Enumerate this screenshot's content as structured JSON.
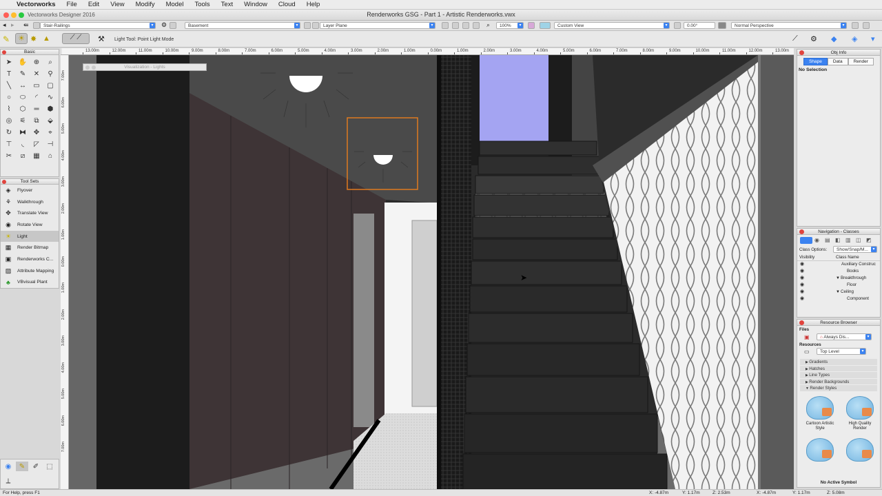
{
  "menubar": {
    "app": "Vectorworks",
    "items": [
      "File",
      "Edit",
      "View",
      "Modify",
      "Model",
      "Tools",
      "Text",
      "Window",
      "Cloud",
      "Help"
    ]
  },
  "window": {
    "app_subtitle": "Vectorworks Designer 2016",
    "title": "Renderworks GSG - Part 1 - Artistic Renderworks.vwx"
  },
  "viewbar": {
    "class": "Stair-Railings",
    "layer": "Basement",
    "plane": "Layer Plane",
    "zoom": "100%",
    "view": "Custom View",
    "angle": "0.00°",
    "projection": "Normal Perspective"
  },
  "modebar": {
    "label": "Light Tool: Point Light Mode"
  },
  "basic_palette": {
    "title": "Basic",
    "tools": [
      "arrow-icon",
      "hand-icon",
      "zoom-marquee-icon",
      "zoom-icon",
      "text-icon",
      "callout-icon",
      "locus-icon",
      "eyedropper-icon",
      "line-icon",
      "dimension-icon",
      "rectangle-icon",
      "rounded-rect-icon",
      "circle-icon",
      "oval-icon",
      "arc-icon",
      "freehand-icon",
      "polyline-icon",
      "polygon-icon",
      "double-line-icon",
      "regular-polygon-icon",
      "spiral-icon",
      "attribute-icon",
      "offset-icon",
      "symbol-icon",
      "rotate-icon",
      "mirror-icon",
      "move-icon",
      "reshape-icon",
      "trim-icon",
      "fillet-icon",
      "chamfer-icon",
      "connect-icon",
      "split-icon",
      "clip-icon",
      "wall-icon",
      "seat-icon"
    ]
  },
  "tool_sets": {
    "title": "Tool Sets",
    "items": [
      {
        "label": "Flyover",
        "icon": "flyover-icon"
      },
      {
        "label": "Walkthrough",
        "icon": "walkthrough-icon"
      },
      {
        "label": "Translate View",
        "icon": "translate-view-icon"
      },
      {
        "label": "Rotate View",
        "icon": "rotate-view-icon"
      },
      {
        "label": "Light",
        "icon": "light-bulb-icon",
        "selected": true
      },
      {
        "label": "Render Bitmap",
        "icon": "render-bitmap-icon"
      },
      {
        "label": "Renderworks C...",
        "icon": "camera-icon"
      },
      {
        "label": "Attribute Mapping",
        "icon": "attribute-mapping-icon"
      },
      {
        "label": "VBvisual Plant",
        "icon": "plant-icon"
      }
    ]
  },
  "ruler": {
    "h_ticks": [
      "13.00m",
      "12.00m",
      "11.00m",
      "10.00m",
      "9.00m",
      "8.00m",
      "7.00m",
      "6.00m",
      "5.00m",
      "4.00m",
      "3.00m",
      "2.00m",
      "1.00m",
      "0.00m",
      "1.00m",
      "2.00m",
      "3.00m",
      "4.00m",
      "5.00m",
      "6.00m",
      "7.00m",
      "8.00m",
      "9.00m",
      "10.00m",
      "11.00m",
      "12.00m",
      "13.00m"
    ],
    "v_ticks": [
      "7.00m",
      "6.00m",
      "5.00m",
      "4.00m",
      "3.00m",
      "2.00m",
      "1.00m",
      "0.00m",
      "1.00m",
      "2.00m",
      "3.00m",
      "4.00m",
      "5.00m",
      "6.00m",
      "7.00m"
    ]
  },
  "viz_palette": {
    "title": "Visualization - Lights"
  },
  "obj_info": {
    "title": "Obj Info",
    "tabs": [
      "Shape",
      "Data",
      "Render"
    ],
    "selection": "No Selection"
  },
  "nav_classes": {
    "title": "Navigation - Classes",
    "class_options_label": "Class Options:",
    "class_options_value": "Show/Snap/M...",
    "col_visibility": "Visibility",
    "col_class_name": "Class Name",
    "rows": [
      "Auxiliary Construc",
      "Books",
      "Breakthrough",
      "Floor",
      "Ceiling",
      "Component"
    ]
  },
  "resource_browser": {
    "title": "Resource Browser",
    "files_label": "Files",
    "file_value": "Always Dis...",
    "resources_label": "Resources",
    "level_value": "Top Level",
    "categories": [
      "Gradients",
      "Hatches",
      "Line Types",
      "Render Backgrounds",
      "Render Styles"
    ],
    "styles": [
      {
        "label": "Cartoon Artistic Style"
      },
      {
        "label": "High Quality Render"
      },
      {
        "label": ""
      },
      {
        "label": ""
      }
    ],
    "no_symbol": "No Active Symbol"
  },
  "status": {
    "help": "For Help, press F1",
    "x1": "X: -4.87m",
    "y1": "Y: 1.17m",
    "z1": "Z: 2.53m",
    "x2": "X: -4.87m",
    "y2": "Y: 1.17m",
    "z2": "Z: 5.08m"
  },
  "colors": {
    "accent": "#3b82f0",
    "sky": "#a4a4f2",
    "wall_dark": "#3e3436",
    "selection_box": "#e07a1f"
  }
}
